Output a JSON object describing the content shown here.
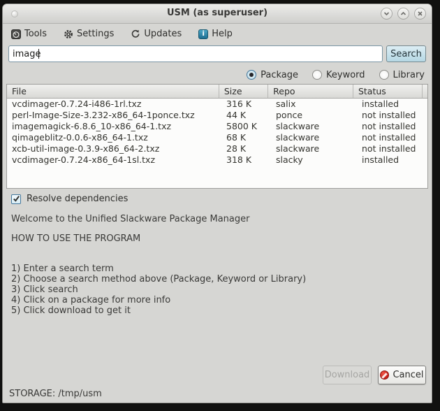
{
  "window": {
    "title": "USM (as superuser)",
    "titlebar_buttons": [
      "shade-icon",
      "maximize-icon",
      "close-icon"
    ]
  },
  "menubar": {
    "items": [
      {
        "label": "Tools",
        "icon": "gauge-icon"
      },
      {
        "label": "Settings",
        "icon": "gear-icon"
      },
      {
        "label": "Updates",
        "icon": "refresh-icon"
      },
      {
        "label": "Help",
        "icon": "info-icon",
        "icon_glyph": "i"
      }
    ]
  },
  "search": {
    "value": "image",
    "button_label": "Search"
  },
  "search_methods": {
    "options": [
      {
        "label": "Package",
        "selected": true
      },
      {
        "label": "Keyword",
        "selected": false
      },
      {
        "label": "Library",
        "selected": false
      }
    ]
  },
  "results_table": {
    "columns": [
      "File",
      "Size",
      "Repo",
      "Status"
    ],
    "rows": [
      {
        "file": "vcdimager-0.7.24-i486-1rl.txz",
        "size": "316 K",
        "repo": "salix",
        "status": "installed"
      },
      {
        "file": "perl-Image-Size-3.232-x86_64-1ponce.txz",
        "size": "44 K",
        "repo": "ponce",
        "status": "not installed"
      },
      {
        "file": "imagemagick-6.8.6_10-x86_64-1.txz",
        "size": "5800 K",
        "repo": "slackware",
        "status": "not installed"
      },
      {
        "file": "qimageblitz-0.0.6-x86_64-1.txz",
        "size": "68 K",
        "repo": "slackware",
        "status": "not installed"
      },
      {
        "file": "xcb-util-image-0.3.9-x86_64-2.txz",
        "size": "28 K",
        "repo": "slackware",
        "status": "not installed"
      },
      {
        "file": "vcdimager-0.7.24-x86_64-1sl.txz",
        "size": "318 K",
        "repo": "slacky",
        "status": "installed"
      }
    ]
  },
  "resolve_dependencies": {
    "label": "Resolve dependencies",
    "checked": true
  },
  "info": {
    "welcome": "Welcome to the Unified Slackware Package Manager",
    "howto": "HOW TO USE THE PROGRAM",
    "steps": [
      "1) Enter a search term",
      "2) Choose a search method above (Package, Keyword or Library)",
      "3) Click search",
      "4) Click on a package for more info",
      "5) Click download to get it"
    ]
  },
  "actions": {
    "download_label": "Download",
    "download_enabled": false,
    "cancel_label": "Cancel"
  },
  "statusbar": {
    "text": "STORAGE: /tmp/usm"
  },
  "colors": {
    "window_bg": "#d6d6d3",
    "search_button_bg": "#bfdde9",
    "help_icon_bg": "#2e86ab",
    "cancel_icon_red": "#c5201a",
    "radio_selected_ring": "#43769b",
    "table_bg": "#fcfcfb"
  }
}
